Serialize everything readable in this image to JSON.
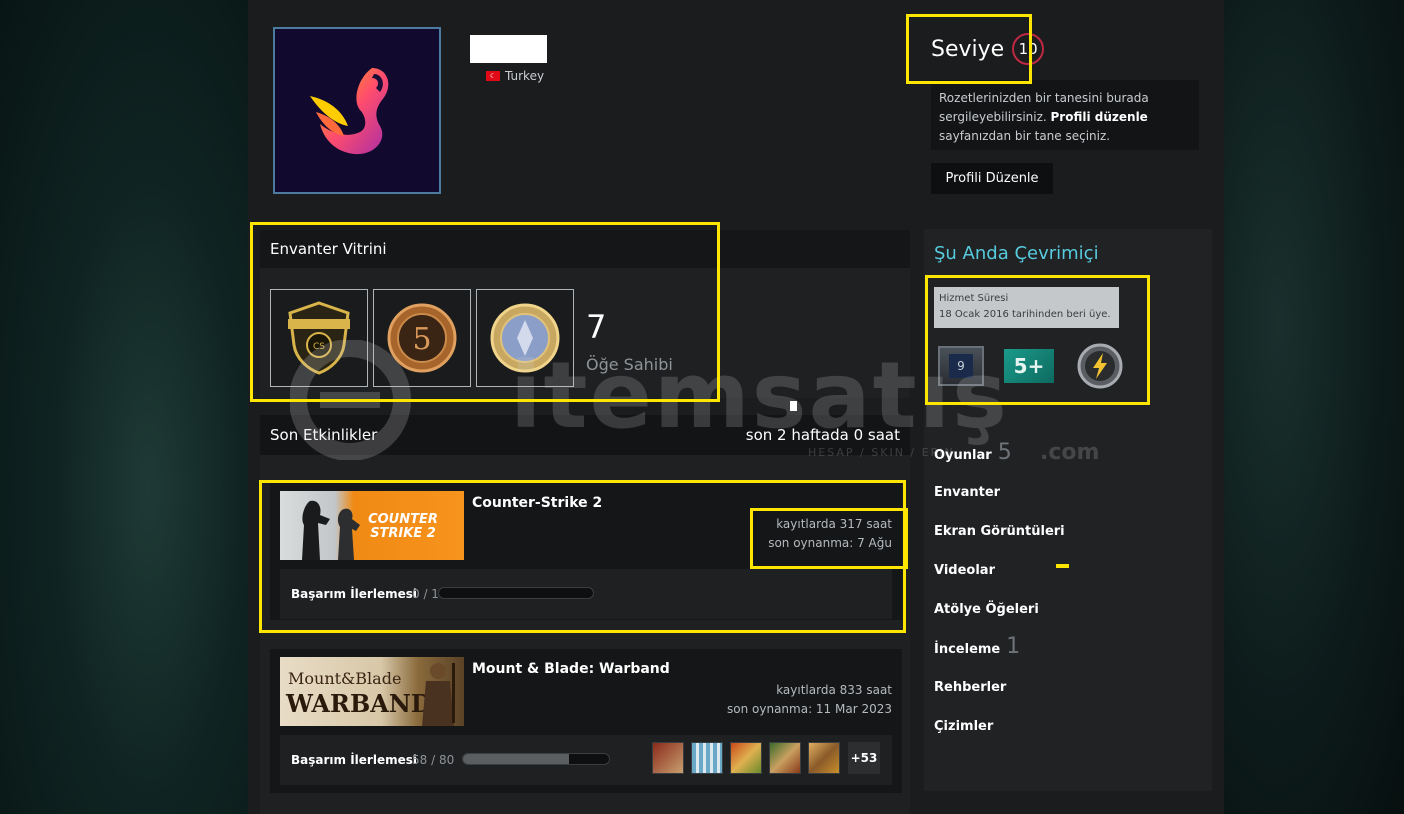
{
  "profile": {
    "country": "Turkey",
    "level_label": "Seviye",
    "level_value": "10",
    "badge_note_1": "Rozetlerinizden bir tanesini burada sergileyebilirsiniz. ",
    "badge_note_link": "Profili düzenle",
    "badge_note_2": " sayfanızdan bir tane seçiniz.",
    "edit_button": "Profili Düzenle"
  },
  "showcase": {
    "title": "Envanter Vitrini",
    "count": "7",
    "count_label": "Öğe Sahibi"
  },
  "recent": {
    "title": "Son Etkinlikler",
    "summary": "son 2 haftada 0 saat",
    "games": [
      {
        "title": "Counter-Strike 2",
        "banner": "COUNTER STRIKE 2",
        "hours": "kayıtlarda 317 saat",
        "last_played": "son oynanma: 7 Ağu",
        "ach_label": "Başarım İlerlemesi",
        "ach_count": "0 / 1",
        "ach_progress": 0.0
      },
      {
        "title": "Mount & Blade: Warband",
        "banner_top": "Mount&Blade",
        "banner_bottom": "WARBAND",
        "hours": "kayıtlarda 833 saat",
        "last_played": "son oynanma: 11 Mar 2023",
        "ach_label": "Başarım İlerlemesi",
        "ach_count": "58 / 80",
        "ach_progress": 0.725,
        "more": "+53"
      }
    ]
  },
  "sidebar": {
    "online": "Şu Anda Çevrimiçi",
    "tooltip_title": "Hizmet Süresi",
    "tooltip_text": "18 Ocak 2016 tarihinden beri üye.",
    "badge_years": "9",
    "badge_five": "5+",
    "nav": [
      {
        "label": "Oyunlar",
        "count": "5"
      },
      {
        "label": "Envanter",
        "count": ""
      },
      {
        "label": "Ekran Görüntüleri",
        "count": ""
      },
      {
        "label": "Videolar",
        "count": ""
      },
      {
        "label": "Atölye Öğeleri",
        "count": ""
      },
      {
        "label": "İnceleme",
        "count": "1"
      },
      {
        "label": "Rehberler",
        "count": ""
      },
      {
        "label": "Çizimler",
        "count": ""
      }
    ]
  },
  "watermark": {
    "brand": "itemsatış",
    "tagline": "HESAP / SKIN / EPIN",
    "domain": ".com"
  },
  "colors": {
    "highlight": "#ffe600",
    "online": "#57cbde",
    "level_ring": "#c02942"
  }
}
